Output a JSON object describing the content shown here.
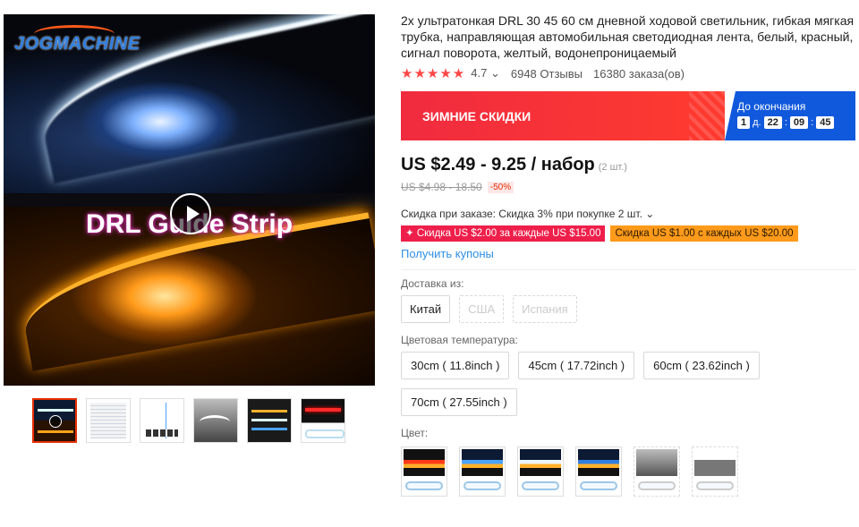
{
  "gallery": {
    "logo": "JOGMACHINE",
    "caption": "DRL Guide Strip",
    "thumbnails": [
      "thumb-1",
      "thumb-2",
      "thumb-3",
      "thumb-4",
      "thumb-5",
      "thumb-6"
    ]
  },
  "product": {
    "title": "2x ультратонкая DRL 30 45 60 см дневной ходовой светильник, гибкая мягкая трубка, направляющая автомобильная светодиодная лента, белый, красный, сигнал поворота, желтый, водонепроницаемый",
    "rating": "4.7",
    "rating_caret": "⌄",
    "reviews": "6948 Отзывы",
    "orders": "16380 заказа(ов)",
    "stars": "★★★★★"
  },
  "banner": {
    "sale_label": "ЗИМНИЕ СКИДКИ",
    "countdown_label": "До окончания",
    "days": "1",
    "days_unit": "д.",
    "hours": "22",
    "minutes": "09",
    "seconds": "45"
  },
  "pricing": {
    "price": "US $2.49 - 9.25 / набор",
    "per": "(2 шт.)",
    "old_price": "US $4.98 - 18.50",
    "discount": "-50%",
    "order_discount": "Скидка при заказе: Скидка 3% при покупке 2 шт. ⌄",
    "coupon1": "✦ Скидка US $2.00 за каждые US $15.00",
    "coupon2": "Скидка US $1.00 с каждых US $20.00",
    "get_coupons": "Получить купоны"
  },
  "shipping": {
    "label": "Доставка из:",
    "options": [
      "Китай",
      "США",
      "Испания"
    ]
  },
  "temperature": {
    "label": "Цветовая температура:",
    "options": [
      "30cm ( 11.8inch )",
      "45cm ( 17.72inch )",
      "60cm ( 23.62inch )",
      "70cm ( 27.55inch )"
    ]
  },
  "color": {
    "label": "Цвет:",
    "swatches": [
      "swatch-1",
      "swatch-2",
      "swatch-3",
      "swatch-4",
      "swatch-5",
      "swatch-6"
    ]
  }
}
